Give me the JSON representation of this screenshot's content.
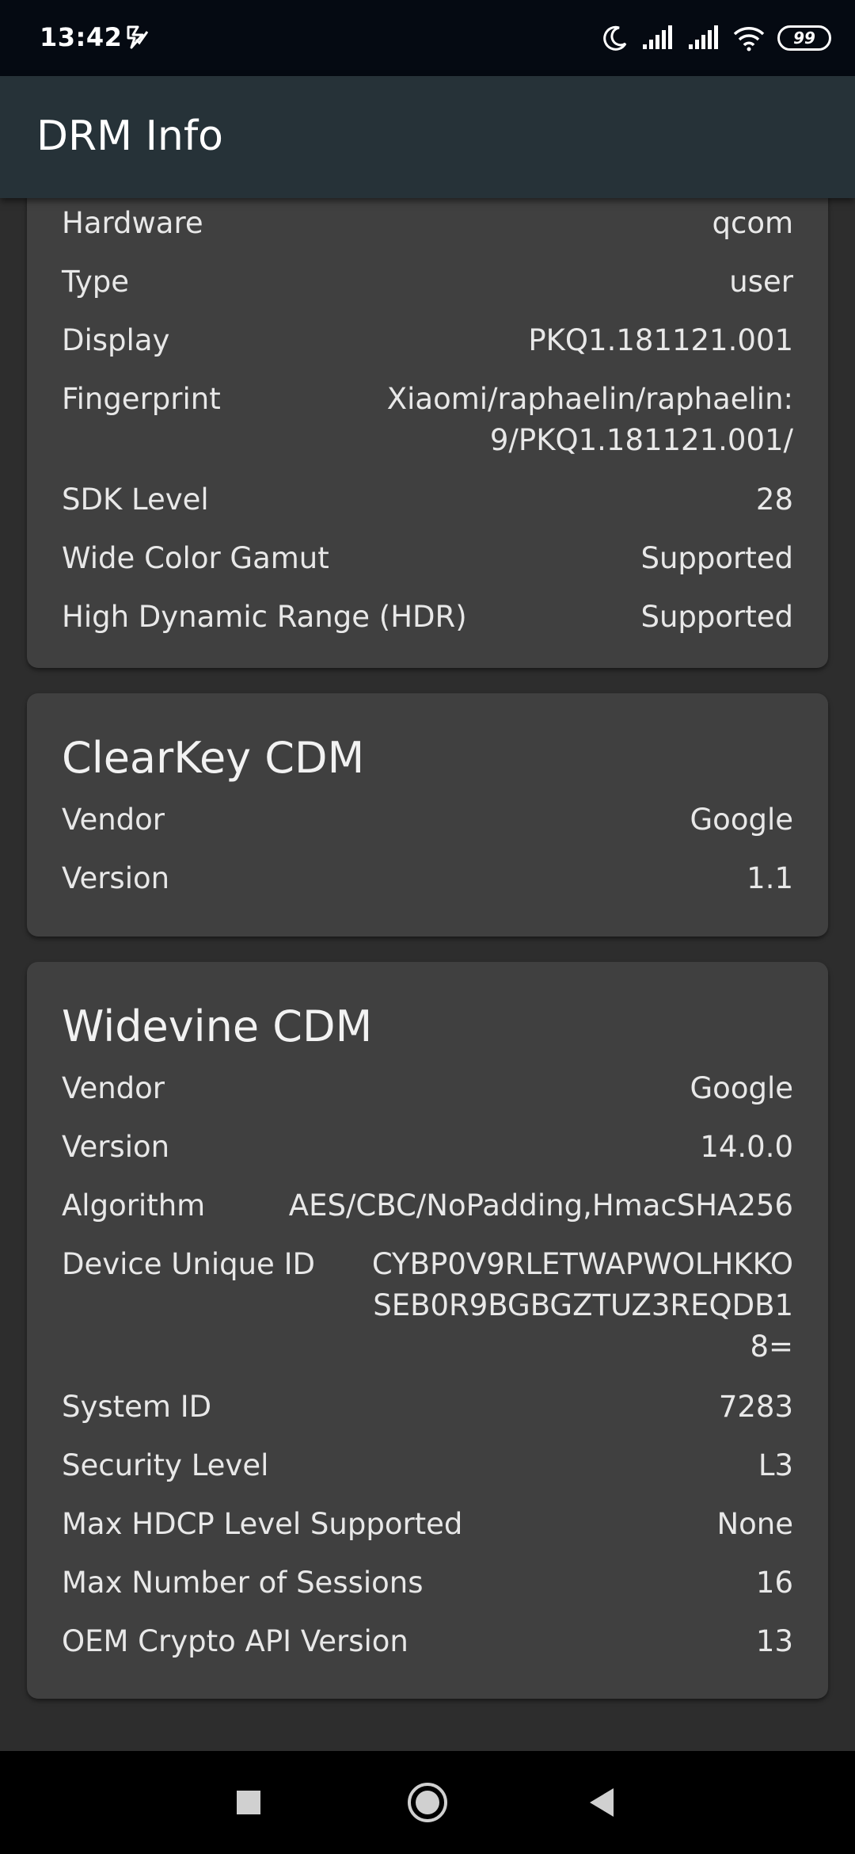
{
  "status_bar": {
    "time": "13:42",
    "battery": "99",
    "icons": [
      "notification-check-icon",
      "moon-icon",
      "signal-icon",
      "signal-icon",
      "wifi-icon",
      "battery-icon"
    ]
  },
  "app_bar": {
    "title": "DRM Info"
  },
  "colors": {
    "app_bar": "#263238",
    "background": "#2d2d2d",
    "card": "#404040",
    "status_bar": "#050a12"
  },
  "device_card": {
    "rows": [
      {
        "label": "Hardware",
        "value": "qcom"
      },
      {
        "label": "Type",
        "value": "user"
      },
      {
        "label": "Display",
        "value": "PKQ1.181121.001"
      },
      {
        "label": "Fingerprint",
        "value": "Xiaomi/raphaelin/raphaelin:\n9/PKQ1.181121.001/"
      },
      {
        "label": "SDK Level",
        "value": "28"
      },
      {
        "label": "Wide Color Gamut",
        "value": "Supported"
      },
      {
        "label": "High Dynamic Range (HDR)",
        "value": "Supported"
      }
    ]
  },
  "clearkey_card": {
    "title": "ClearKey CDM",
    "rows": [
      {
        "label": "Vendor",
        "value": "Google"
      },
      {
        "label": "Version",
        "value": "1.1"
      }
    ]
  },
  "widevine_card": {
    "title": "Widevine CDM",
    "rows": [
      {
        "label": "Vendor",
        "value": "Google"
      },
      {
        "label": "Version",
        "value": "14.0.0"
      },
      {
        "label": "Algorithm",
        "value": "AES/CBC/NoPadding,HmacSHA256"
      },
      {
        "label": "Device Unique ID",
        "value": "CYBP0V9RLETWAPWOLHKKO\nSEB0R9BGBGZTUZ3REQDB1\n8="
      },
      {
        "label": "System ID",
        "value": "7283"
      },
      {
        "label": "Security Level",
        "value": "L3"
      },
      {
        "label": "Max HDCP Level Supported",
        "value": "None"
      },
      {
        "label": "Max Number of Sessions",
        "value": "16"
      },
      {
        "label": "OEM Crypto API Version",
        "value": "13"
      }
    ]
  },
  "nav_bar": {
    "buttons": [
      "recents-square-icon",
      "home-circle-icon",
      "back-triangle-icon"
    ]
  }
}
